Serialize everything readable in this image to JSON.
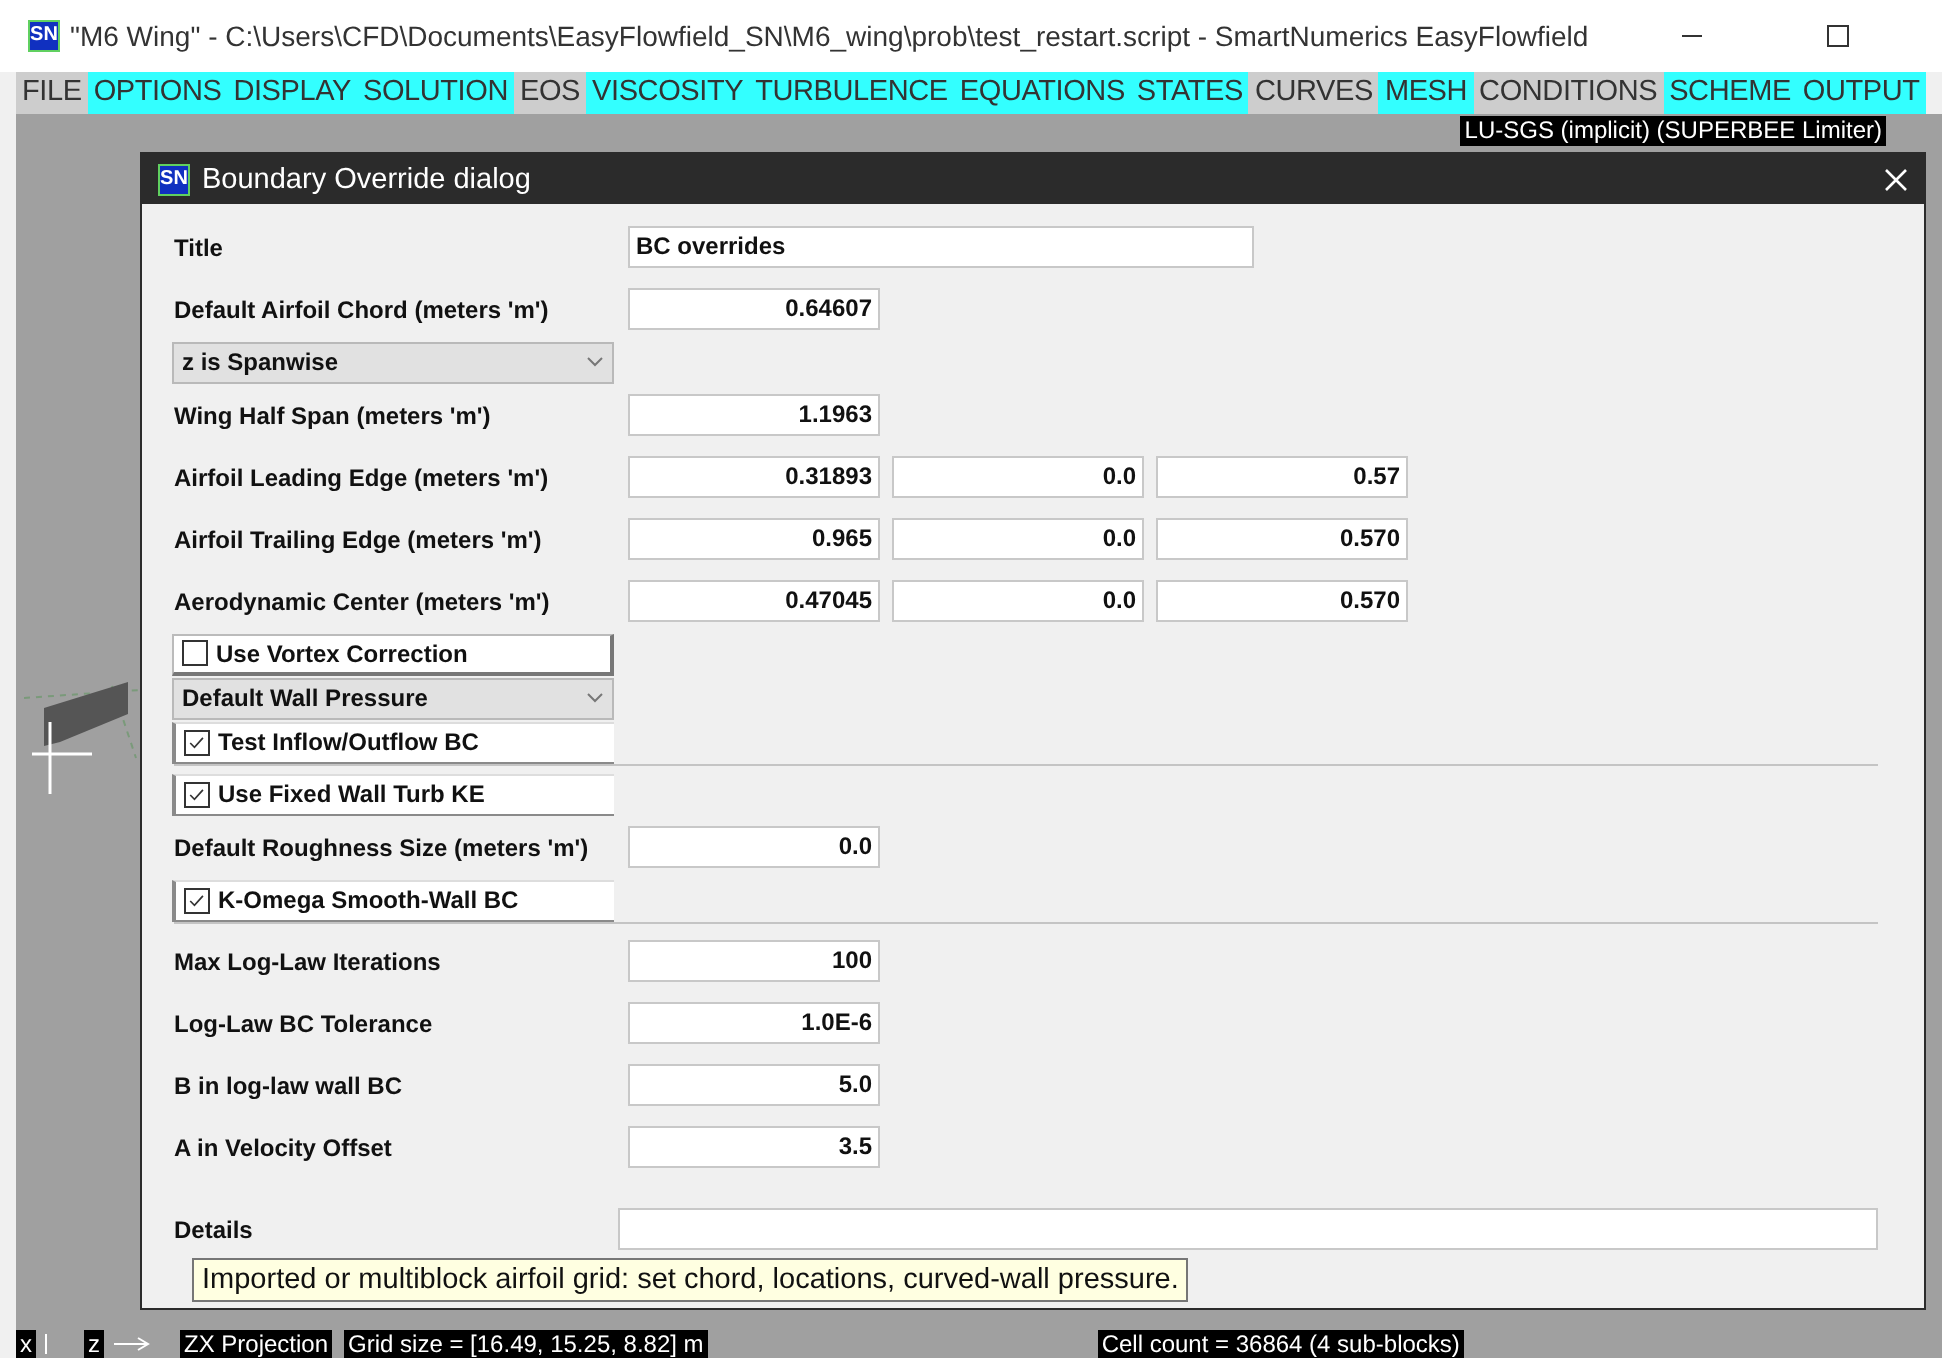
{
  "window": {
    "app_icon": "SN",
    "title": "\"M6 Wing\" - C:\\Users\\CFD\\Documents\\EasyFlowfield_SN\\M6_wing\\prob\\test_restart.script - SmartNumerics EasyFlowfield"
  },
  "menu": [
    {
      "label": "FILE",
      "highlighted": false
    },
    {
      "label": "OPTIONS",
      "highlighted": true
    },
    {
      "label": "DISPLAY",
      "highlighted": true
    },
    {
      "label": "SOLUTION",
      "highlighted": true
    },
    {
      "label": "EOS",
      "highlighted": false
    },
    {
      "label": "VISCOSITY",
      "highlighted": true
    },
    {
      "label": "TURBULENCE",
      "highlighted": true
    },
    {
      "label": "EQUATIONS",
      "highlighted": true
    },
    {
      "label": "STATES",
      "highlighted": true
    },
    {
      "label": "CURVES",
      "highlighted": false
    },
    {
      "label": "MESH",
      "highlighted": true
    },
    {
      "label": "CONDITIONS",
      "highlighted": false
    },
    {
      "label": "SCHEME",
      "highlighted": true
    },
    {
      "label": "OUTPUT",
      "highlighted": true
    }
  ],
  "viewport": {
    "scheme_label": "LU-SGS (implicit) (SUPERBEE Limiter)",
    "axis_labels": [
      "x",
      "z"
    ],
    "projection": "ZX Projection",
    "grid_size": "Grid size = [16.49, 15.25, 8.82] m",
    "cell_count": "Cell count = 36864 (4 sub-blocks)"
  },
  "dialog": {
    "icon": "SN",
    "title": "Boundary Override dialog",
    "rows": [
      {
        "kind": "text",
        "label": "Title",
        "values": [
          "BC overrides"
        ]
      },
      {
        "kind": "number",
        "label": "Default Airfoil Chord (meters 'm')",
        "values": [
          "0.64607"
        ]
      },
      {
        "kind": "select",
        "value": "z is Spanwise"
      },
      {
        "kind": "number",
        "label": "Wing Half Span (meters 'm')",
        "values": [
          "1.1963"
        ]
      },
      {
        "kind": "number",
        "label": "Airfoil Leading Edge (meters 'm')",
        "values": [
          "0.31893",
          "0.0",
          "0.57"
        ]
      },
      {
        "kind": "number",
        "label": "Airfoil Trailing Edge (meters 'm')",
        "values": [
          "0.965",
          "0.0",
          "0.570"
        ]
      },
      {
        "kind": "number",
        "label": "Aerodynamic Center (meters 'm')",
        "values": [
          "0.47045",
          "0.0",
          "0.570"
        ]
      },
      {
        "kind": "checkbox",
        "label": "Use Vortex Correction",
        "checked": false
      },
      {
        "kind": "select",
        "value": "Default Wall Pressure"
      },
      {
        "kind": "checkbox",
        "label": "Test Inflow/Outflow BC",
        "checked": true
      },
      {
        "kind": "separator"
      },
      {
        "kind": "checkbox",
        "label": "Use Fixed Wall Turb KE",
        "checked": true
      },
      {
        "kind": "number",
        "label": "Default Roughness Size (meters 'm')",
        "values": [
          "0.0"
        ]
      },
      {
        "kind": "checkbox",
        "label": "K-Omega Smooth-Wall BC",
        "checked": true
      },
      {
        "kind": "separator"
      },
      {
        "kind": "number",
        "label": "Max Log-Law Iterations",
        "values": [
          "100"
        ]
      },
      {
        "kind": "number",
        "label": "Log-Law BC Tolerance",
        "values": [
          "1.0E-6"
        ]
      },
      {
        "kind": "number",
        "label": "B in log-law wall BC",
        "values": [
          "5.0"
        ]
      },
      {
        "kind": "number",
        "label": "A in Velocity Offset",
        "values": [
          "3.5"
        ]
      },
      {
        "kind": "long_text",
        "label": "Details"
      }
    ],
    "tooltip": "Imported or multiblock airfoil grid: set chord, locations, curved-wall pressure."
  }
}
